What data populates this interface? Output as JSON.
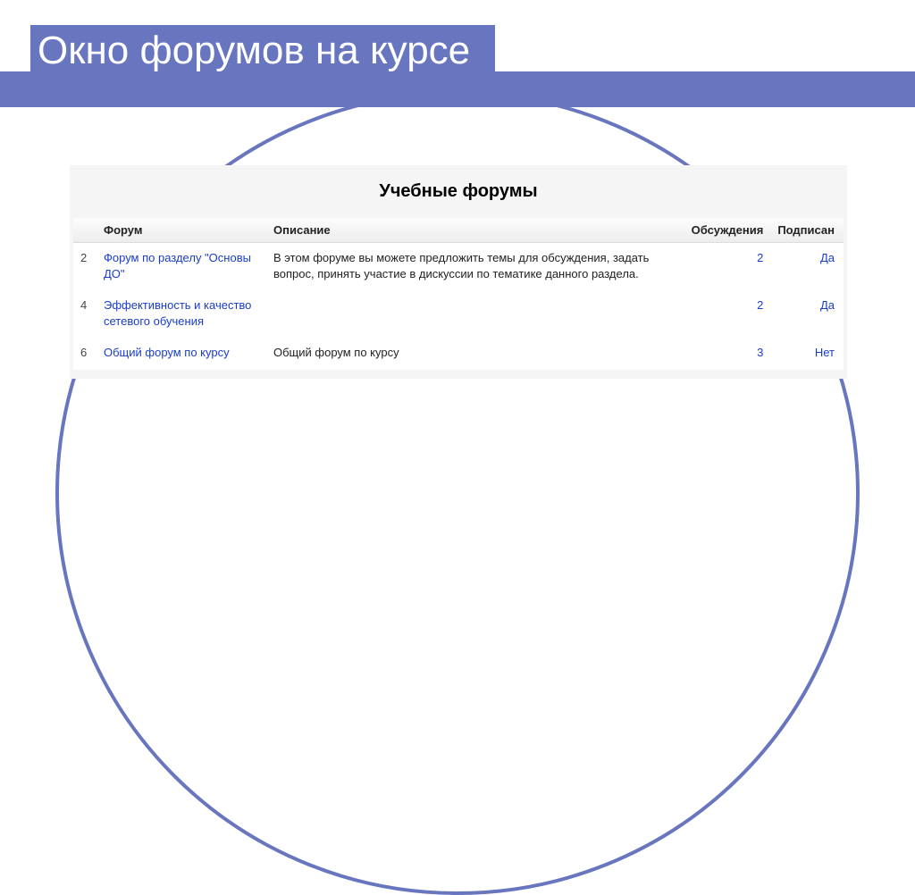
{
  "slide": {
    "title": "Окно форумов на курсе"
  },
  "panel": {
    "title": "Учебные форумы",
    "columns": {
      "idx": "",
      "forum": "Форум",
      "desc": "Описание",
      "disc": "Обсуждения",
      "sub": "Подписан"
    },
    "rows": [
      {
        "idx": "2",
        "forum": "Форум по разделу \"Основы ДО\"",
        "desc": "В этом форуме вы можете предложить темы для обсуждения, задать вопрос, принять участие в дискуссии по тематике данного раздела.",
        "disc": "2",
        "sub": "Да"
      },
      {
        "idx": "4",
        "forum": "Эффективность и качество сетевого обучения",
        "desc": "",
        "disc": "2",
        "sub": "Да"
      },
      {
        "idx": "6",
        "forum": "Общий форум по курсу",
        "desc": "Общий форум по курсу",
        "disc": "3",
        "sub": "Нет"
      }
    ]
  }
}
